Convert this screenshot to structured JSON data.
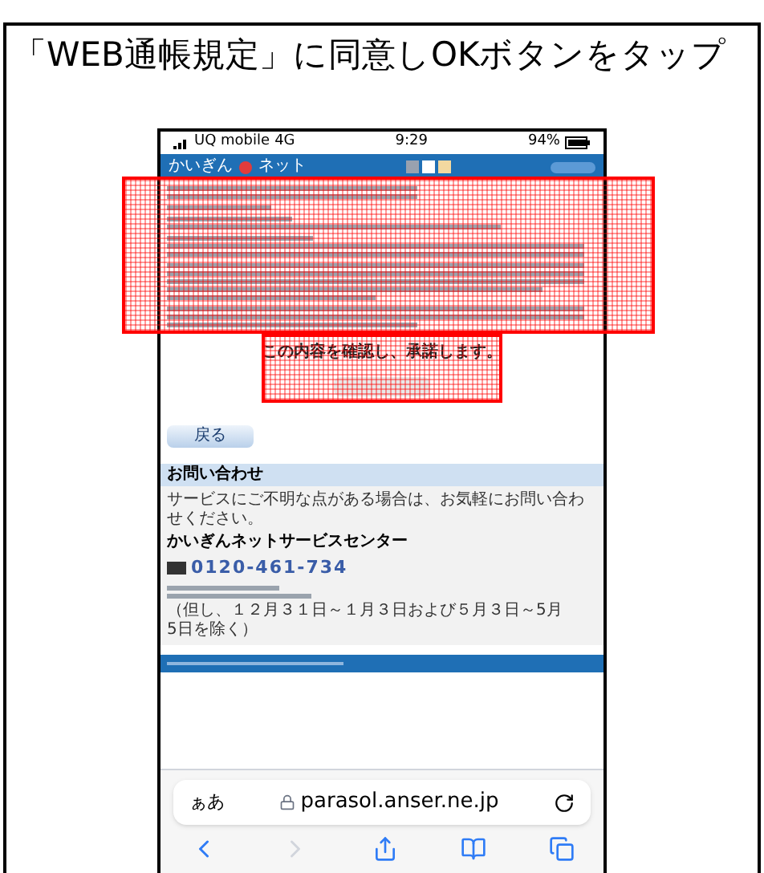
{
  "title": "「WEB通帳規定」に同意しOKボタンをタップ",
  "status_bar": {
    "carrier": "UQ mobile",
    "network": "4G",
    "time": "9:29",
    "battery": "94%"
  },
  "site_header": {
    "logo_left": "かいぎん",
    "logo_right": "ネット"
  },
  "terms": {
    "confirm_text": "この内容を確認し、承諾します。"
  },
  "back_button": "戻る",
  "contact": {
    "heading": "お問い合わせ",
    "message": "サービスにご不明な点がある場合は、お気軽にお問い合わせください。",
    "center": "かいぎんネットサービスセンター",
    "phone": "0120-461-734",
    "note": "（但し、１２月３１日～１月３日および５月３日～5月5日を除く）"
  },
  "browser": {
    "text_size": "ぁあ",
    "url": "parasol.anser.ne.jp"
  }
}
